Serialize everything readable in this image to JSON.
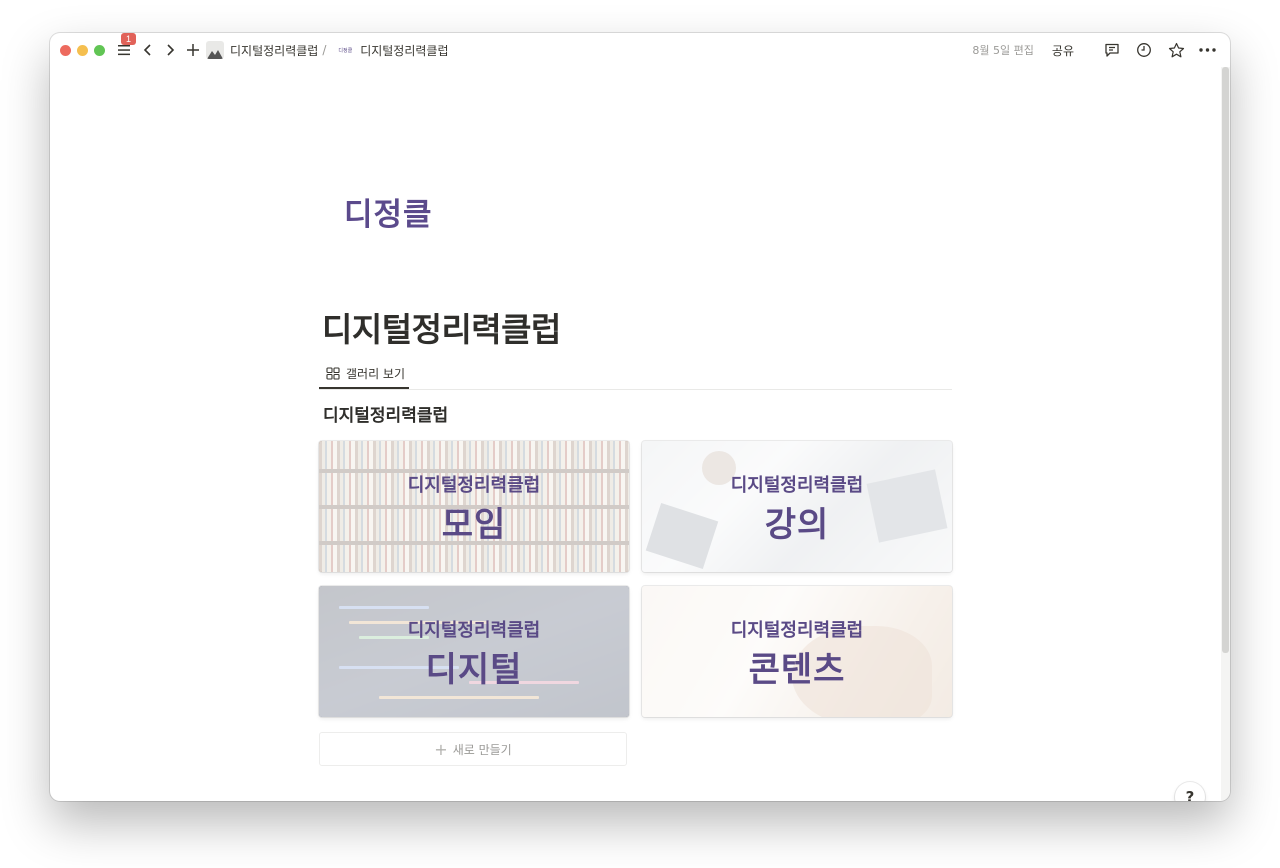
{
  "titlebar": {
    "badge_count": "1",
    "breadcrumb_root": "디지털정리력클럽",
    "breadcrumb_sep": "/",
    "breadcrumb_mini": "디정클",
    "breadcrumb_current": "디지털정리력클럽",
    "edited": "8월 5일 편집",
    "share": "공유"
  },
  "page": {
    "logo_text": "디정클",
    "title": "디지털정리력클럽",
    "tab_label": "갤러리 보기",
    "db_title": "디지털정리력클럽"
  },
  "gallery": {
    "cards": [
      {
        "caption": "디지털정리력클럽",
        "title": "모임"
      },
      {
        "caption": "디지털정리력클럽",
        "title": "강의"
      },
      {
        "caption": "디지털정리력클럽",
        "title": "디지털"
      },
      {
        "caption": "디지털정리력클럽",
        "title": "콘텐츠"
      }
    ],
    "new_label": "새로 만들기"
  },
  "help_label": "?",
  "colors": {
    "accent": "#5a4a86",
    "text": "#37352f",
    "muted": "#9b9a97",
    "badge": "#e16259"
  }
}
